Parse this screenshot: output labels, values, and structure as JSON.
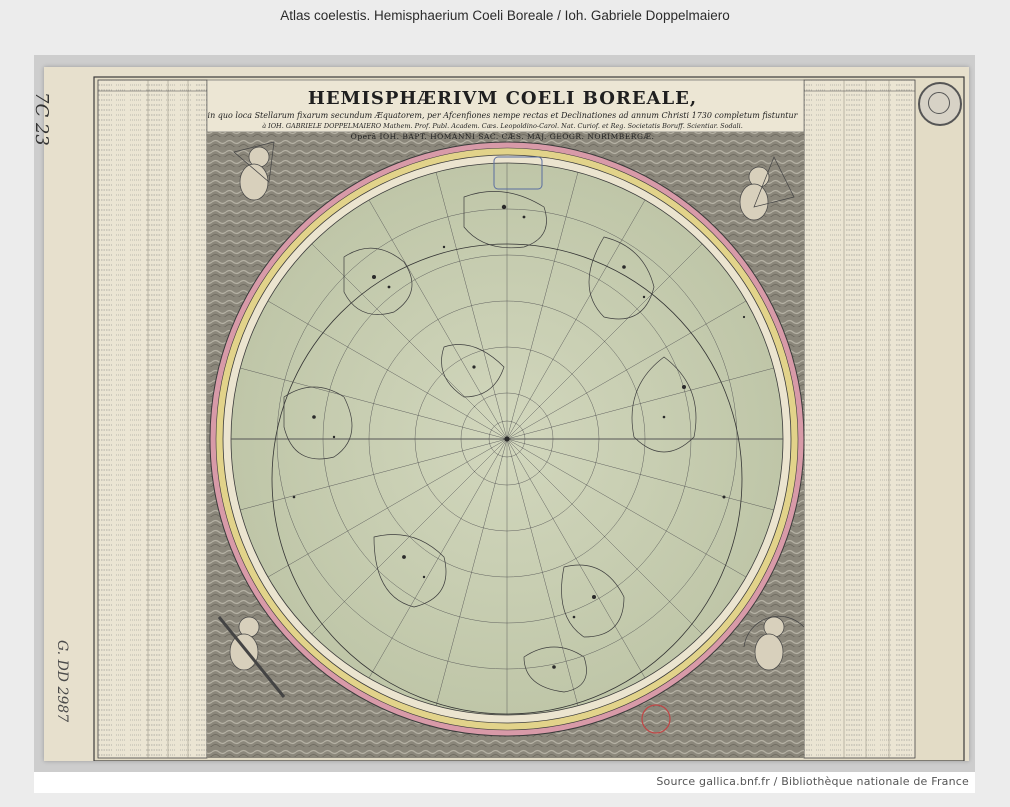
{
  "page": {
    "title": "Atlas coelestis. Hemisphaerium Coeli Boreale / Ioh. Gabriele Doppelmaiero"
  },
  "source": {
    "text": "Source gallica.bnf.fr / Bibliothèque nationale de France"
  },
  "map": {
    "title": "HEMISPHÆRIVM COELI BOREALE,",
    "subtitle": "in quo loca Stellarum fixarum secundum Æquatorem, per Afcenfiones nempe rectas et Declinationes ad annum Christi 1730 completum fistuntur",
    "author": "à IOH. GABRIELE DOPPELMAIERO Mathem. Prof. Publ. Academ. Cæs. Leopoldino-Carol. Nat. Curiof. et Reg. Societatis Boruff. Scientiar. Sodali.",
    "opera": "Operâ IOH. BAPT. HOMANNI SAC. CÆS. MAJ. GEOGR. NORIMBERGÆ.",
    "shelf_mark": "7C 23",
    "shelf_mark_2": "G. DD 2987",
    "colors": {
      "paper": "#e7e0cd",
      "sky": "#c9cfb3",
      "ring_yellow": "#e2d38a",
      "ring_pink": "#d89aa8",
      "ink": "#2a2a2a",
      "clouds": "#7e7a6f"
    }
  }
}
